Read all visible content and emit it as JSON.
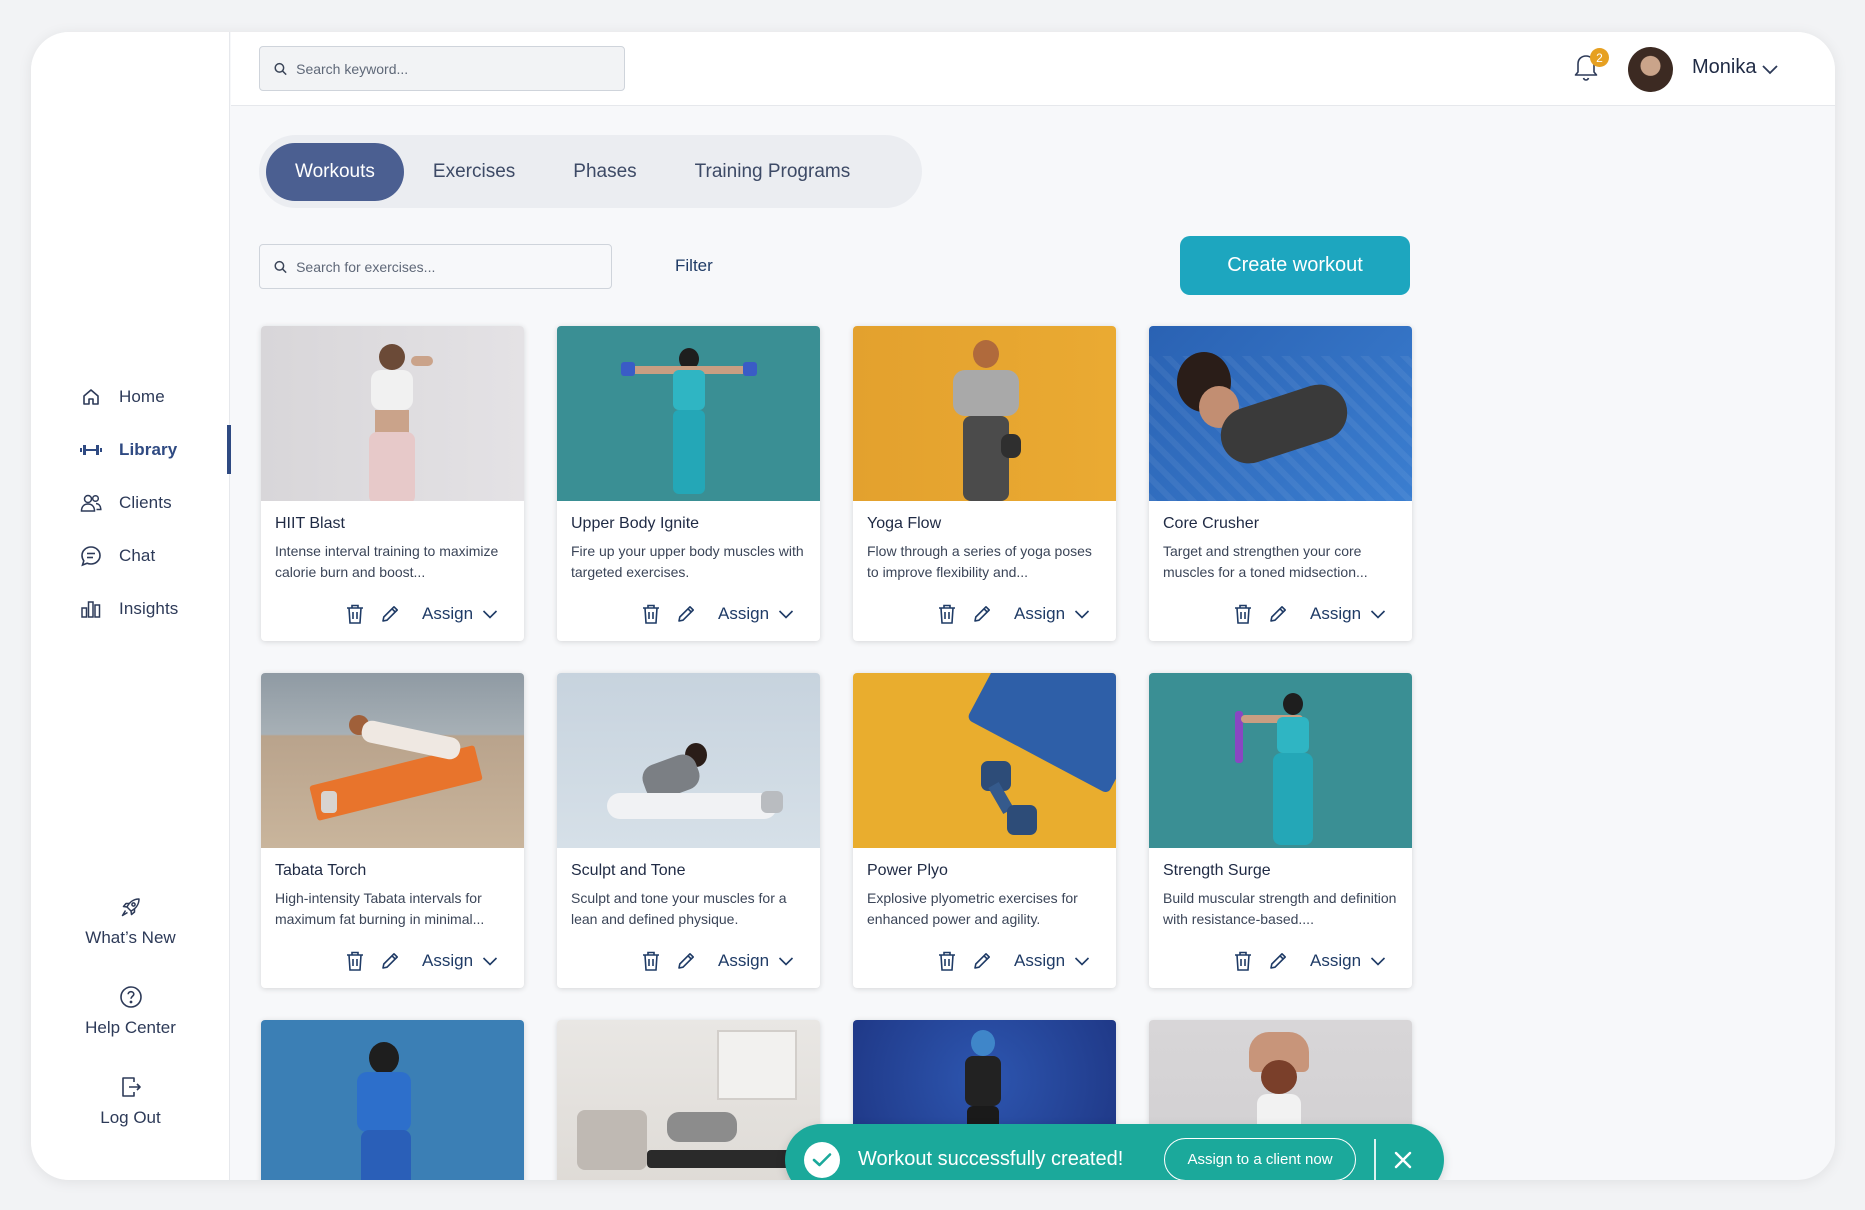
{
  "app": {
    "user_name": "Monika",
    "notification_count": "2",
    "top_search_placeholder": "Search keyword..."
  },
  "sidebar": {
    "items": [
      {
        "label": "Home",
        "icon": "home-icon"
      },
      {
        "label": "Library",
        "icon": "dumbbell-icon",
        "active": true
      },
      {
        "label": "Clients",
        "icon": "users-icon"
      },
      {
        "label": "Chat",
        "icon": "chat-icon"
      },
      {
        "label": "Insights",
        "icon": "bar-chart-icon"
      }
    ],
    "bottom": [
      {
        "label": "What’s New",
        "icon": "rocket-icon"
      },
      {
        "label": "Help Center",
        "icon": "help-icon"
      },
      {
        "label": "Log Out",
        "icon": "logout-icon"
      }
    ]
  },
  "tabs": [
    {
      "label": "Workouts",
      "active": true
    },
    {
      "label": "Exercises"
    },
    {
      "label": "Phases"
    },
    {
      "label": "Training Programs"
    }
  ],
  "toolbar": {
    "search_placeholder": "Search for exercises...",
    "filter_label": "Filter",
    "create_label": "Create workout"
  },
  "cards": [
    {
      "title": "HIIT Blast",
      "desc": "Intense interval training to maximize calorie burn and boost...",
      "assign": "Assign"
    },
    {
      "title": "Upper Body Ignite",
      "desc": "Fire up your upper body muscles with targeted exercises.",
      "assign": "Assign"
    },
    {
      "title": "Yoga Flow",
      "desc": "Flow through a series of yoga poses to improve flexibility and...",
      "assign": "Assign"
    },
    {
      "title": "Core Crusher",
      "desc": "Target and strengthen your core muscles for a toned midsection...",
      "assign": "Assign"
    },
    {
      "title": "Tabata Torch",
      "desc": "High-intensity Tabata intervals for maximum fat burning in minimal...",
      "assign": "Assign"
    },
    {
      "title": "Sculpt and Tone",
      "desc": "Sculpt and tone your muscles for a lean and defined physique.",
      "assign": "Assign"
    },
    {
      "title": "Power Plyo",
      "desc": "Explosive plyometric exercises for enhanced power and agility.",
      "assign": "Assign"
    },
    {
      "title": "Strength Surge",
      "desc": "Build muscular strength and definition with resistance-based....",
      "assign": "Assign"
    }
  ],
  "toast": {
    "message": "Workout successfully created!",
    "action_label": "Assign to a client now"
  },
  "colors": {
    "accent": "#1da6bf",
    "tab_active": "#4b5f91",
    "toast": "#1ba99b",
    "badge": "#e6a021"
  }
}
